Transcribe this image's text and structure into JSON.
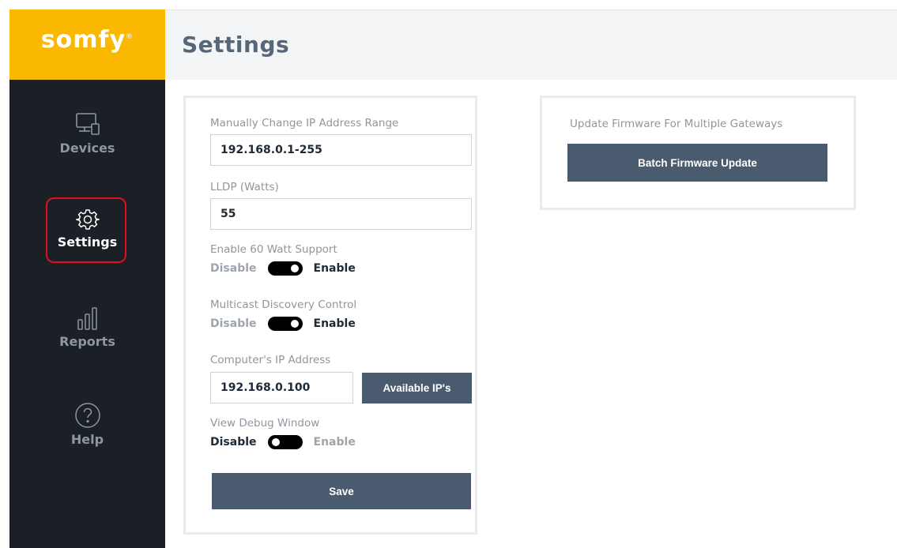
{
  "brand": {
    "logo_text": "somfy",
    "logo_mark": "®",
    "brand_color": "#fbb800",
    "sidebar_color": "#1b1f26",
    "button_color": "#4b5b6f",
    "highlight_color": "#e01020"
  },
  "sidebar": {
    "items": [
      {
        "label": "Devices",
        "icon": "monitor-icon",
        "active": false
      },
      {
        "label": "Settings",
        "icon": "gear-icon",
        "active": true
      },
      {
        "label": "Reports",
        "icon": "bar-chart-icon",
        "active": false
      },
      {
        "label": "Help",
        "icon": "help-circle-icon",
        "active": false
      }
    ]
  },
  "header": {
    "title": "Settings"
  },
  "settings": {
    "ip_range": {
      "label": "Manually Change IP Address Range",
      "value": "192.168.0.1-255"
    },
    "lldp": {
      "label": "LLDP (Watts)",
      "value": "55"
    },
    "watt60": {
      "label": "Enable 60 Watt Support",
      "off_label": "Disable",
      "on_label": "Enable",
      "state": "enabled"
    },
    "multicast": {
      "label": "Multicast Discovery Control",
      "off_label": "Disable",
      "on_label": "Enable",
      "state": "enabled"
    },
    "computer_ip": {
      "label": "Computer's IP Address",
      "value": "192.168.0.100",
      "button_label": "Available IP's"
    },
    "debug": {
      "label": "View Debug Window",
      "off_label": "Disable",
      "on_label": "Enable",
      "state": "disabled"
    },
    "save_label": "Save"
  },
  "firmware": {
    "label": "Update Firmware For Multiple Gateways",
    "button_label": "Batch Firmware Update"
  }
}
